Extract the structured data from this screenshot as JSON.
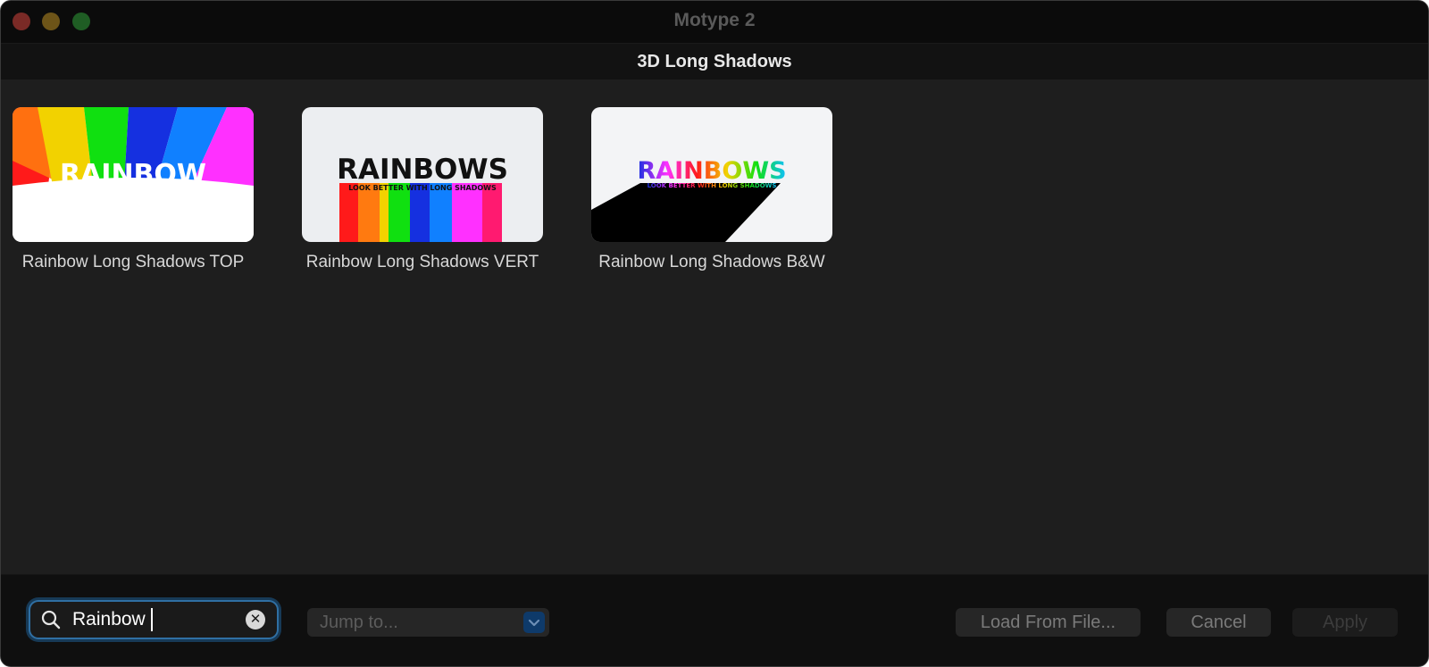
{
  "window": {
    "title": "Motype 2"
  },
  "subheader": {
    "title": "3D Long Shadows"
  },
  "presets": [
    {
      "label": "Rainbow Long Shadows TOP",
      "thumb_text": "RAINBOW"
    },
    {
      "label": "Rainbow Long Shadows VERT",
      "thumb_text": "RAINBOWS",
      "thumb_subtext": "LOOK BETTER WITH LONG SHADOWS"
    },
    {
      "label": "Rainbow Long Shadows B&W",
      "thumb_text": "RAINBOWS",
      "thumb_subtext": "LOOK BETTER WITH LONG SHADOWS"
    }
  ],
  "footer": {
    "search": {
      "value": "Rainbow"
    },
    "jump": {
      "placeholder": "Jump to..."
    },
    "load_label": "Load From File...",
    "cancel_label": "Cancel",
    "apply_label": "Apply"
  },
  "colors": {
    "rainbow": [
      "#ff1a1a",
      "#ff7a10",
      "#f2d200",
      "#10e010",
      "#1530e0",
      "#1080ff",
      "#ff30ff"
    ],
    "focus_ring": "#2f6fa3"
  },
  "icons": {
    "search": "magnifier-icon",
    "clear": "clear-circle-x-icon",
    "dropdown": "chevron-down-icon"
  }
}
